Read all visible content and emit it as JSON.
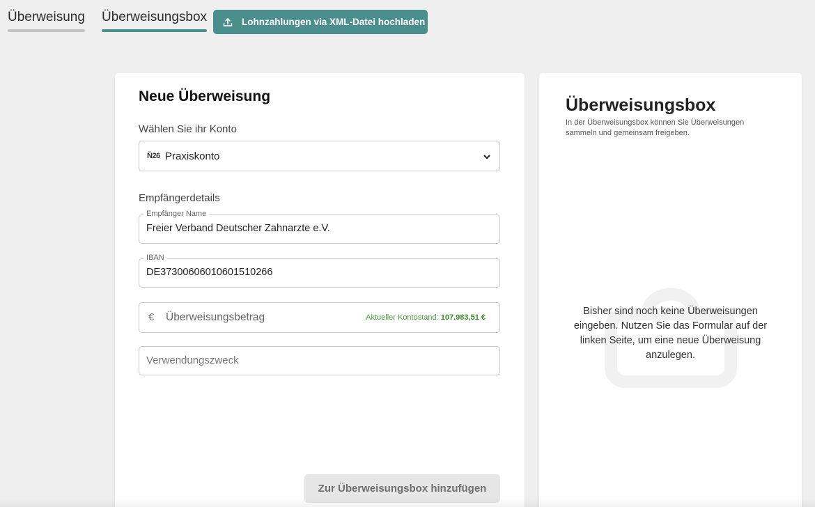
{
  "tabs": [
    {
      "label": "Überweisung",
      "active": false
    },
    {
      "label": "Überweisungsbox",
      "active": true
    }
  ],
  "upload": {
    "label": "Lohnzahlungen via XML-Datei hochladen",
    "icon": "upload-icon"
  },
  "form": {
    "title": "Neue Überweisung",
    "account_label": "Wählen Sie ihr Konto",
    "account": {
      "bank_logo": "N̄26",
      "selected": "Praxiskonto",
      "icon": "chevron-down-icon"
    },
    "recipient_section": "Empfängerdetails",
    "recipient_name": {
      "label": "Empfänger Name",
      "value": "Freier Verband Deutscher Zahnarzte e.V."
    },
    "iban": {
      "label": "IBAN",
      "value": "DE37300606010601510266"
    },
    "amount": {
      "currency_symbol": "€",
      "placeholder": "Überweisungsbetrag",
      "balance_label": "Aktueller Kontostand:",
      "balance_value": "107.983,51 €"
    },
    "purpose": {
      "placeholder": "Verwendungszweck"
    },
    "submit_label": "Zur Überweisungsbox hinzufügen"
  },
  "box": {
    "title": "Überweisungsbox",
    "subtitle": "In der Überweisungsbox können Sie Überweisungen sammeln und gemeinsam freigeben.",
    "empty_text": "Bisher sind noch keine Überweisungen eingeben. Nutzen Sie das Formular auf der linken Seite, um eine neue Überweisung anzulegen.",
    "empty_icon": "bag-icon"
  },
  "colors": {
    "accent": "#4b8f8c",
    "balance_green": "#3e8b2f",
    "background": "#efefef"
  }
}
